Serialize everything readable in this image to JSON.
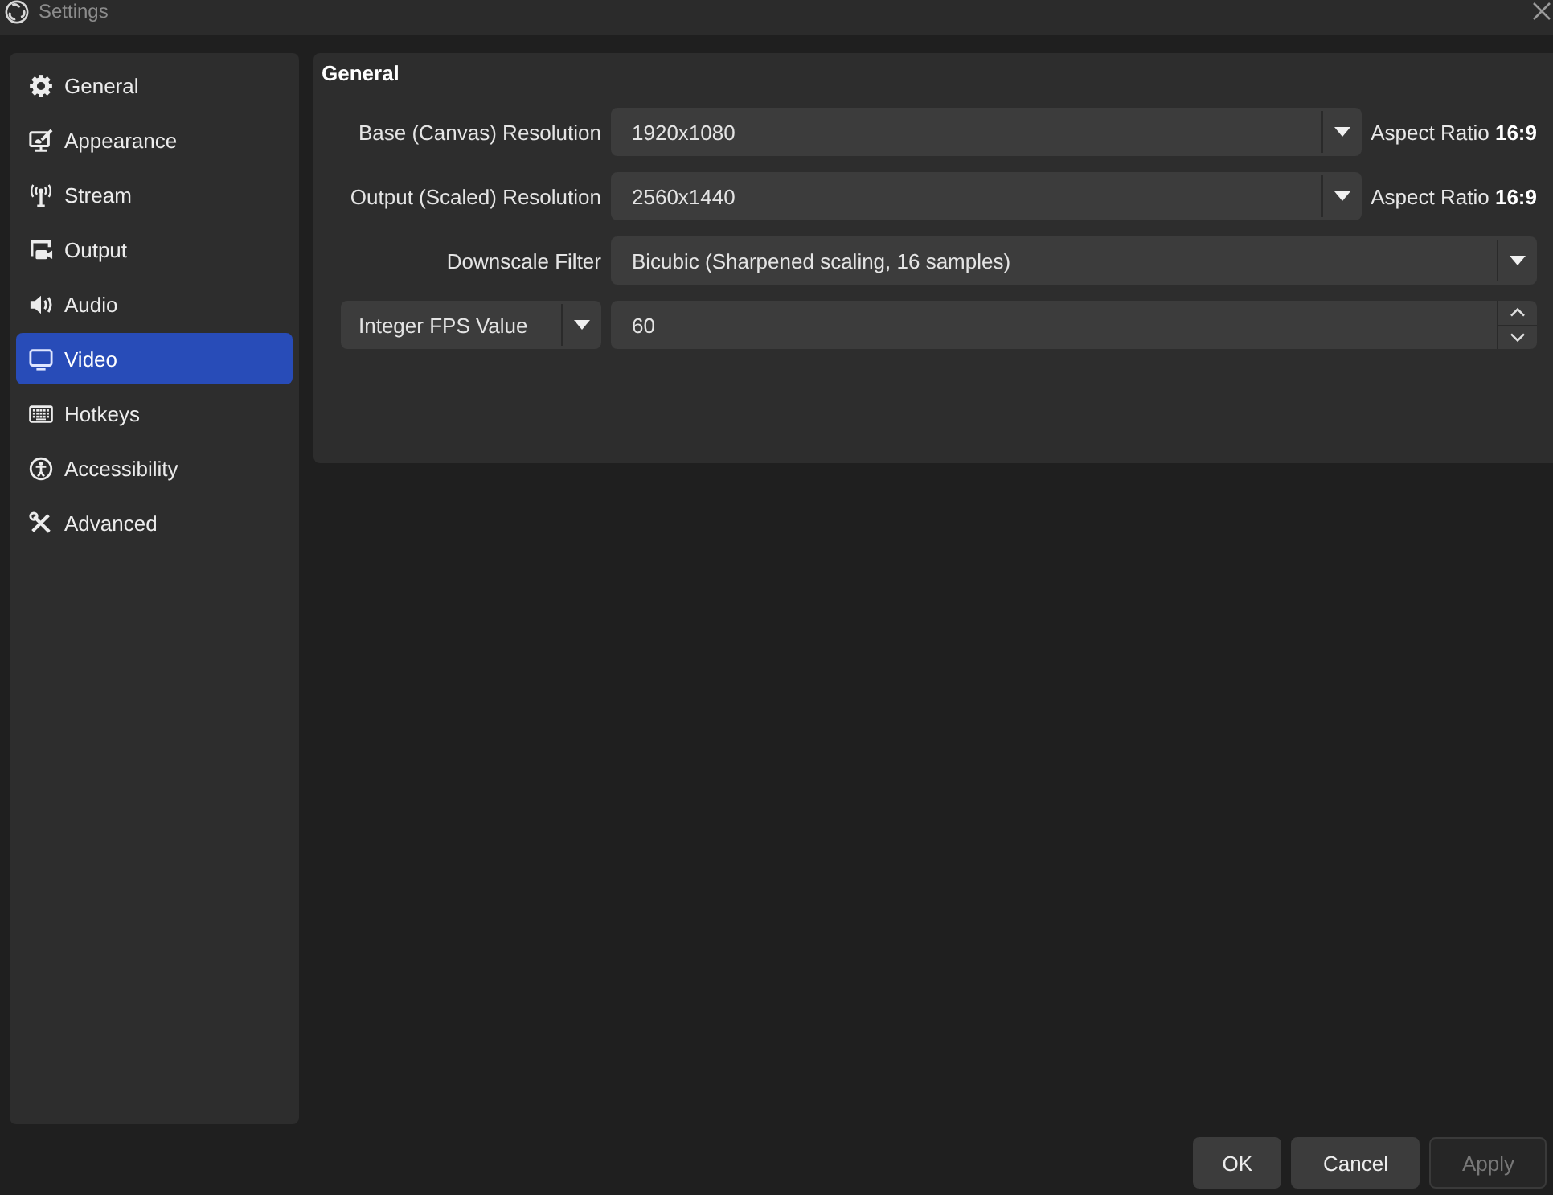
{
  "window": {
    "title": "Settings"
  },
  "sidebar": {
    "items": [
      {
        "label": "General",
        "selected": false
      },
      {
        "label": "Appearance",
        "selected": false
      },
      {
        "label": "Stream",
        "selected": false
      },
      {
        "label": "Output",
        "selected": false
      },
      {
        "label": "Audio",
        "selected": false
      },
      {
        "label": "Video",
        "selected": true
      },
      {
        "label": "Hotkeys",
        "selected": false
      },
      {
        "label": "Accessibility",
        "selected": false
      },
      {
        "label": "Advanced",
        "selected": false
      }
    ]
  },
  "panel": {
    "title": "General",
    "rows": [
      {
        "kind": "dropdown",
        "label": "Base (Canvas) Resolution",
        "value": "1920x1080",
        "note": "Aspect Ratio **16:9**"
      },
      {
        "kind": "dropdown",
        "label": "Output (Scaled) Resolution",
        "value": "2560x1440",
        "note": "Aspect Ratio **16:9**"
      },
      {
        "kind": "dropdown",
        "label": "Downscale Filter",
        "value": "Bicubic (Sharpened scaling, 16 samples)"
      },
      {
        "kind": "spin",
        "mode": "Integer FPS Value",
        "value": "60"
      }
    ]
  },
  "buttons": [
    {
      "label": "OK",
      "disabled": false
    },
    {
      "label": "Cancel",
      "disabled": false
    },
    {
      "label": "Apply",
      "disabled": true
    }
  ]
}
